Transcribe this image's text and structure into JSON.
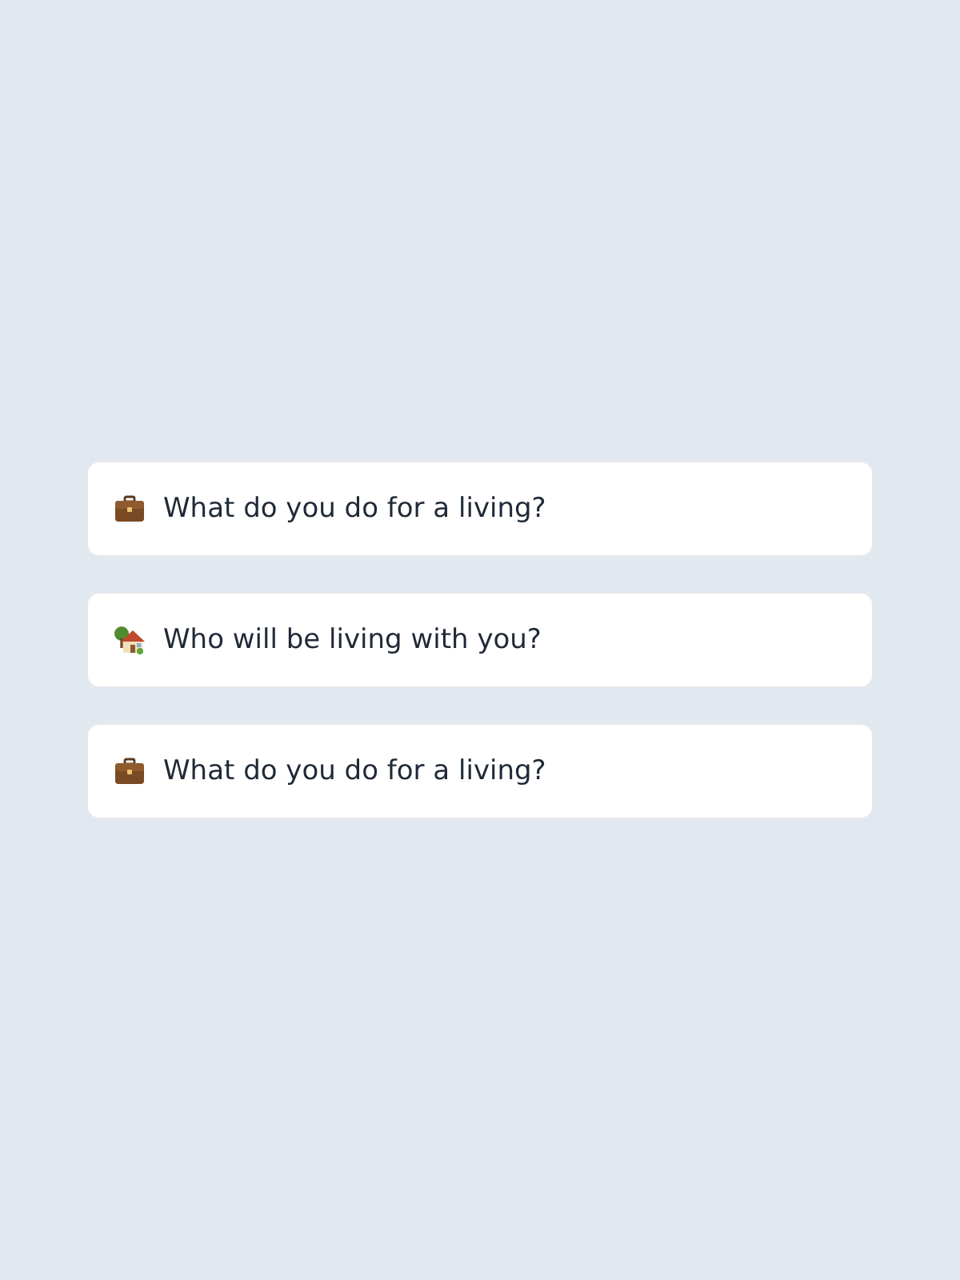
{
  "questions": [
    {
      "kind": "briefcase",
      "label": "What do you do for a living?"
    },
    {
      "kind": "house",
      "label": "Who will be living with you?"
    },
    {
      "kind": "briefcase",
      "label": "What do you do for a living?"
    }
  ]
}
